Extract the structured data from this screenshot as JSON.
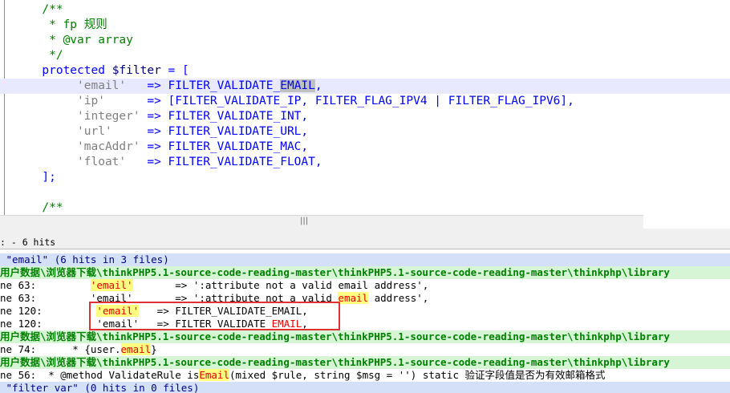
{
  "editor": {
    "lines": {
      "l1": "/**",
      "l2": " * fp 规则",
      "l3": " * @var array",
      "l4": " */",
      "l5_kw": "protected",
      "l5_var": "$filter",
      "l5_rest": " = [",
      "rows": [
        {
          "key": "'email'",
          "pad": "   ",
          "arrow": "=>",
          "value": "FILTER_VALIDATE_EMAIL,"
        },
        {
          "key": "'ip'",
          "pad": "      ",
          "arrow": "=>",
          "value": "[FILTER_VALIDATE_IP, FILTER_FLAG_IPV4 | FILTER_FLAG_IPV6],"
        },
        {
          "key": "'integer'",
          "pad": " ",
          "arrow": "=>",
          "value": "FILTER_VALIDATE_INT,"
        },
        {
          "key": "'url'",
          "pad": "     ",
          "arrow": "=>",
          "value": "FILTER_VALIDATE_URL,"
        },
        {
          "key": "'macAddr'",
          "pad": " ",
          "arrow": "=>",
          "value": "FILTER_VALIDATE_MAC,"
        },
        {
          "key": "'float'",
          "pad": "   ",
          "arrow": "=>",
          "value": "FILTER_VALIDATE_FLOAT,"
        }
      ],
      "email_prefix": "FILTER_VALIDATE_",
      "email_word": "EMAIL",
      "email_suffix": ",",
      "close": "];",
      "l_last": "/**"
    }
  },
  "scrollbar": {
    "grip": "|||"
  },
  "results_title": ": - 6 hits",
  "results": {
    "search1": " \"email\" (6 hits in 3 files)",
    "file1": "用户数据\\浏览器下载\\thinkPHP5.1-source-code-reading-master\\thinkPHP5.1-source-code-reading-master\\thinkphp\\library",
    "hit1": {
      "prefix": "ne 63:         ",
      "word": "'email'",
      "rest": "       => ':attribute not a valid email address',"
    },
    "hit2": {
      "prefix": "ne 63:         'email'       => ':attribute not a valid ",
      "word": "email",
      "rest": " address',"
    },
    "hit3": {
      "prefix": "ne 120:         ",
      "word": "'email'",
      "rest": "   => FILTER_VALIDATE_EMAIL,"
    },
    "hit4": {
      "prefix": "ne 120:         'email'   => FILTER_VALIDATE_",
      "word": "EMAIL",
      "rest": ","
    },
    "file2": "用户数据\\浏览器下载\\thinkPHP5.1-source-code-reading-master\\thinkPHP5.1-source-code-reading-master\\thinkphp\\library",
    "hit5": {
      "prefix": "ne 74:      * {user.",
      "word": "email",
      "rest": "}"
    },
    "file3": "用户数据\\浏览器下载\\thinkPHP5.1-source-code-reading-master\\thinkPHP5.1-source-code-reading-master\\thinkphp\\library",
    "hit6": {
      "prefix": "ne 56:  * @method ValidateRule is",
      "word": "Email",
      "rest": "(mixed $rule, string $msg = '') static 验证字段值是否为有效邮箱格式"
    },
    "search2": " \"filter var\" (0 hits in 0 files)"
  },
  "colors": {
    "comment": "#008000",
    "keyword": "#0000ff",
    "string": "#808080",
    "search_header_bg": "#d4e0f7",
    "file_row_bg": "#d5f5d5",
    "hit_highlight": "#ffff80",
    "annotation_box": "#e03232"
  }
}
